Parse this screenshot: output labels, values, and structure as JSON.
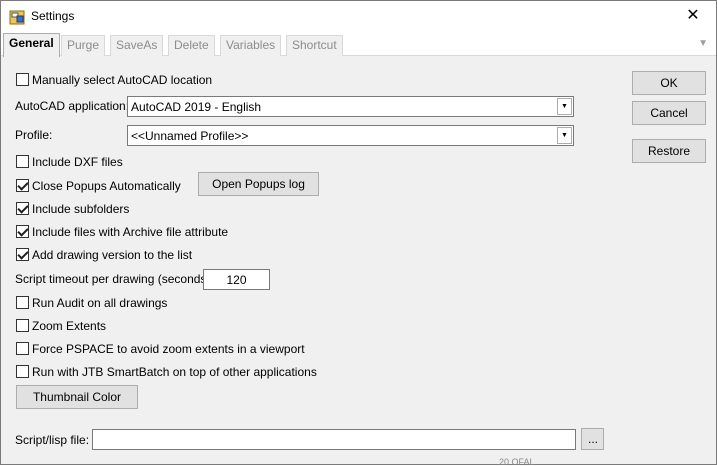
{
  "window": {
    "title": "Settings",
    "close_glyph": "✕"
  },
  "tabs": [
    {
      "label": "General",
      "active": true
    },
    {
      "label": "Purge"
    },
    {
      "label": "SaveAs"
    },
    {
      "label": "Delete"
    },
    {
      "label": "Variables"
    },
    {
      "label": "Shortcut"
    }
  ],
  "tab_overflow_glyph": "▼",
  "general": {
    "manual_location": {
      "label": "Manually select AutoCAD location",
      "checked": false
    },
    "autocad_app": {
      "label": "AutoCAD application:",
      "value": "AutoCAD 2019 - English"
    },
    "profile": {
      "label": "Profile:",
      "value": "<<Unnamed Profile>>"
    },
    "include_dxf": {
      "label": "Include DXF files",
      "checked": false
    },
    "close_popups": {
      "label": "Close Popups Automatically",
      "checked": true
    },
    "open_popups_log": "Open Popups log",
    "include_subfolders": {
      "label": "Include subfolders",
      "checked": true
    },
    "include_archive": {
      "label": "Include files with Archive file attribute",
      "checked": true
    },
    "add_drawing_version": {
      "label": "Add drawing version to the list",
      "checked": true
    },
    "script_timeout": {
      "label": "Script timeout per drawing (seconds):",
      "value": "120"
    },
    "run_audit": {
      "label": "Run Audit on all drawings",
      "checked": false
    },
    "zoom_extents": {
      "label": "Zoom Extents",
      "checked": false
    },
    "force_pspace": {
      "label": "Force PSPACE to avoid zoom extents in a viewport",
      "checked": false
    },
    "run_on_top": {
      "label": "Run with JTB SmartBatch on top of other applications",
      "checked": false
    },
    "thumbnail_color": "Thumbnail Color",
    "script_file": {
      "label": "Script/lisp file:",
      "value": "",
      "browse": "..."
    }
  },
  "buttons": {
    "ok": "OK",
    "cancel": "Cancel",
    "restore": "Restore"
  },
  "corner_text": "20 OFAL"
}
